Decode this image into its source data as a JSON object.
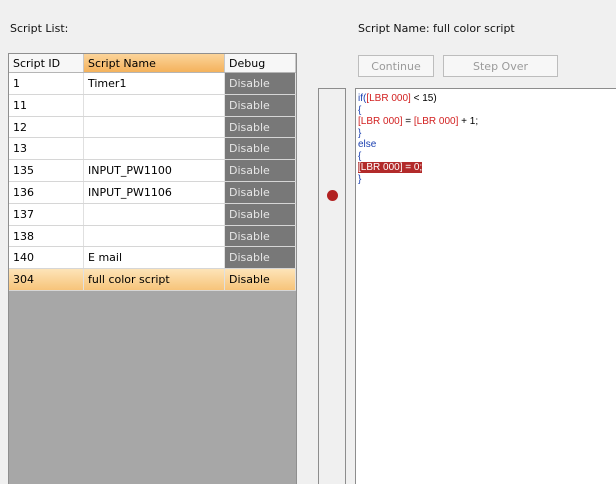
{
  "labels": {
    "script_list": "Script List:",
    "script_name": "Script Name: full color script"
  },
  "table": {
    "headers": [
      "Script ID",
      "Script Name",
      "Debug"
    ],
    "selected_header": "Script Name",
    "rows": [
      {
        "id": "1",
        "name": "Timer1",
        "debug": "Disable"
      },
      {
        "id": "11",
        "name": "",
        "debug": "Disable"
      },
      {
        "id": "12",
        "name": "",
        "debug": "Disable"
      },
      {
        "id": "13",
        "name": "",
        "debug": "Disable"
      },
      {
        "id": "135",
        "name": "INPUT_PW1100",
        "debug": "Disable"
      },
      {
        "id": "136",
        "name": "INPUT_PW1106",
        "debug": "Disable"
      },
      {
        "id": "137",
        "name": "",
        "debug": "Disable"
      },
      {
        "id": "138",
        "name": "",
        "debug": "Disable"
      },
      {
        "id": "140",
        "name": "E mail",
        "debug": "Disable"
      },
      {
        "id": "304",
        "name": "full color script",
        "debug": "Disable"
      }
    ],
    "selected_row": "304"
  },
  "buttons": {
    "continue": "Continue",
    "step_over": "Step Over"
  },
  "editor": {
    "breakpoint_line": 6,
    "lines": [
      [
        {
          "t": "if(",
          "c": "kw"
        },
        {
          "t": "[LBR 000]",
          "c": "lbr"
        },
        {
          "t": " < 15)",
          "c": "plain"
        }
      ],
      [
        {
          "t": "{",
          "c": "kw"
        }
      ],
      [
        {
          "t": "[LBR 000]",
          "c": "lbr"
        },
        {
          "t": " = ",
          "c": "plain"
        },
        {
          "t": "[LBR 000]",
          "c": "lbr"
        },
        {
          "t": " + 1;",
          "c": "plain"
        }
      ],
      [
        {
          "t": "}",
          "c": "kw"
        }
      ],
      [
        {
          "t": "else",
          "c": "kw"
        }
      ],
      [
        {
          "t": "{",
          "c": "kw"
        }
      ],
      [
        {
          "t": "[LBR 000] = 0;",
          "c": "hl"
        }
      ],
      [
        {
          "t": "}",
          "c": "kw"
        }
      ]
    ]
  },
  "colors": {
    "selection": "#f7c47a",
    "debug_cell": "#787878",
    "breakpoint": "#b22222",
    "keyword": "#1a3fb0",
    "register": "#d21f1f"
  }
}
